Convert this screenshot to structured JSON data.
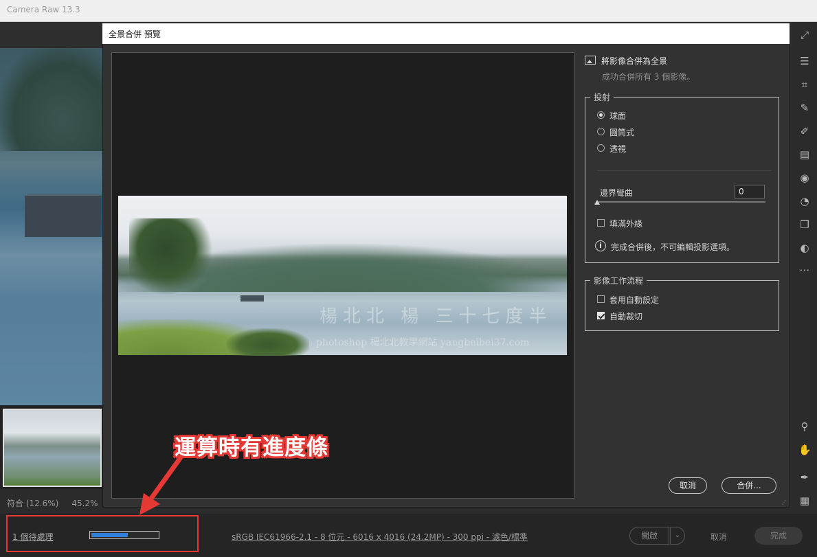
{
  "window": {
    "title": "Camera Raw 13.3"
  },
  "dialog": {
    "title": "全景合併 預覽",
    "header": {
      "title": "將影像合併為全景",
      "subtitle": "成功合併所有 3 個影像。"
    },
    "projection": {
      "label": "投射",
      "options": [
        {
          "label": "球面",
          "selected": true
        },
        {
          "label": "圓筒式",
          "selected": false
        },
        {
          "label": "透視",
          "selected": false
        }
      ],
      "boundary_warp_label": "邊界彎曲",
      "boundary_warp_value": "0",
      "boundary_warp_level": 0,
      "fill_edges_label": "填滿外緣",
      "fill_edges_checked": false,
      "info_text": "完成合併後，不可編輯投影選項。"
    },
    "workflow": {
      "label": "影像工作流程",
      "apply_auto_label": "套用自動設定",
      "apply_auto_checked": false,
      "auto_crop_label": "自動裁切",
      "auto_crop_checked": true
    },
    "buttons": {
      "cancel": "取消",
      "merge": "合併..."
    },
    "preview_watermark": {
      "line1": "楊北北 楊 三十七度半",
      "line2": "photoshop 楊北北教學網站 yangbeibei37.com"
    }
  },
  "left_panel": {
    "zoom_label": "符合 (12.6%)",
    "zoom_percent": "45.2%"
  },
  "bottom_bar": {
    "status_label": "1 個待處理",
    "progress": 0.55,
    "file_info": "sRGB IEC61966-2.1 - 8 位元 - 6016 x 4016 (24.2MP) - 300 ppi - 濾色/標準",
    "open_button": "開啟",
    "cancel_button": "取消",
    "done_button": "完成"
  },
  "annotation": {
    "text": "運算時有進度條",
    "color": "#e53935"
  },
  "right_icons": [
    "expand-icon",
    "sliders-icon",
    "crop-icon",
    "healing-icon",
    "brush-icon",
    "gradient-icon",
    "radial-icon",
    "redeye-icon",
    "snapshots-icon",
    "presets-icon",
    "more-icon",
    "zoom-icon",
    "hand-icon",
    "color-sampler-icon",
    "grid-icon"
  ],
  "colors": {
    "progress_fill": "#2f7fd8",
    "accent_red": "#e53935"
  }
}
